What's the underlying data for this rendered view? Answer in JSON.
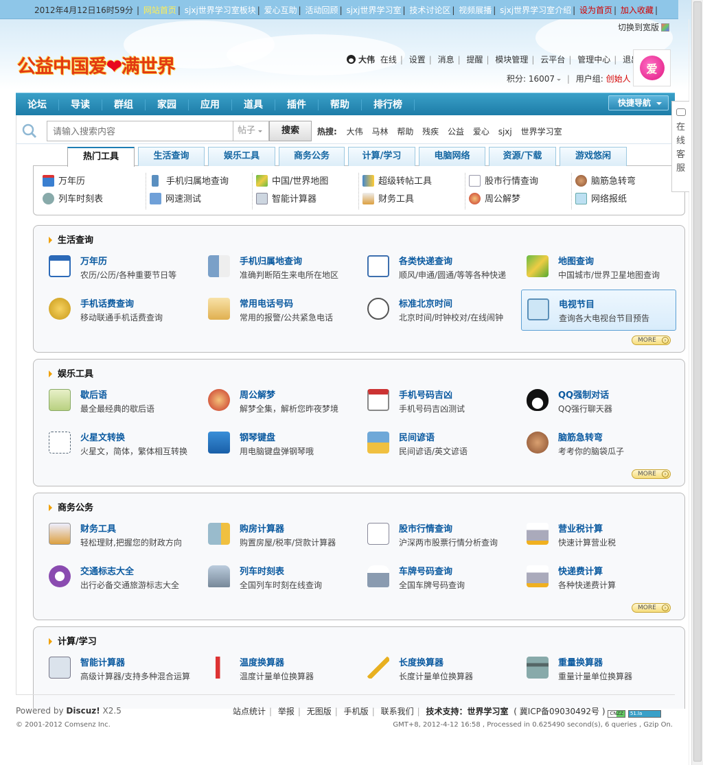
{
  "topbar": {
    "datetime": "2012年4月12日16时59分",
    "links": [
      "网站首页",
      "sjxj世界学习室板块",
      "爱心互助",
      "活动回顾",
      "sjxj世界学习室",
      "技术讨论区",
      "视频展播",
      "sjxj世界学习室介绍",
      "设为首页",
      "加入收藏"
    ]
  },
  "wide_toggle": "切换到宽版",
  "logo": {
    "text_a": "公益中国爱",
    "text_b": "满世界",
    "heart": "❤"
  },
  "user": {
    "name": "大伟",
    "status": "在线",
    "menu": [
      "设置",
      "消息",
      "提醒",
      "模块管理",
      "云平台",
      "管理中心",
      "退出"
    ],
    "points_label": "积分: 16007",
    "group_label": "用户组:",
    "group": "创始人",
    "avatar_text": "爱"
  },
  "nav": {
    "items": [
      "论坛",
      "导读",
      "群组",
      "家园",
      "应用",
      "道具",
      "插件",
      "帮助",
      "排行榜"
    ],
    "quick": "快捷导航"
  },
  "search": {
    "placeholder": "请输入搜索内容",
    "type": "帖子",
    "button": "搜索",
    "hot_label": "热搜:",
    "hot": [
      "大伟",
      "马林",
      "帮助",
      "残疾",
      "公益",
      "爱心",
      "sjxj",
      "世界学习室"
    ]
  },
  "side": {
    "chars": [
      "在",
      "线",
      "客",
      "服"
    ]
  },
  "tabs": [
    "热门工具",
    "生活查询",
    "娱乐工具",
    "商务公务",
    "计算/学习",
    "电脑网络",
    "资源/下载",
    "游戏悠闲"
  ],
  "hot_tools": {
    "row1": [
      "万年历",
      "手机归属地查询",
      "中国/世界地图",
      "超级转帖工具",
      "股市行情查询",
      "脑筋急转弯"
    ],
    "row2": [
      "列车时刻表",
      "网速测试",
      "智能计算器",
      "财务工具",
      "周公解梦",
      "网络报纸"
    ]
  },
  "sections": [
    {
      "title": "生活查询",
      "items": [
        {
          "t": "万年历",
          "d": "农历/公历/各种重要节日等"
        },
        {
          "t": "手机归属地查询",
          "d": "准确判断陌生来电所在地区"
        },
        {
          "t": "各类快递查询",
          "d": "顺风/申通/圆通/等等各种快递"
        },
        {
          "t": "地图查询",
          "d": "中国城市/世界卫星地图查询"
        },
        {
          "t": "手机话费查询",
          "d": "移动联通手机话费查询"
        },
        {
          "t": "常用电话号码",
          "d": "常用的报警/公共紧急电话"
        },
        {
          "t": "标准北京时间",
          "d": "北京时间/时钟校对/在线闹钟"
        },
        {
          "t": "电视节目",
          "d": "查询各大电视台节目预告"
        }
      ],
      "more": "MORE"
    },
    {
      "title": "娱乐工具",
      "items": [
        {
          "t": "歇后语",
          "d": "最全最经典的歇后语"
        },
        {
          "t": "周公解梦",
          "d": "解梦全集，解析您昨夜梦境"
        },
        {
          "t": "手机号码吉凶",
          "d": "手机号码吉凶测试"
        },
        {
          "t": "QQ强制对话",
          "d": "QQ强行聊天器"
        },
        {
          "t": "火星文转换",
          "d": "火星文，简体，繁体相互转换"
        },
        {
          "t": "钢琴键盘",
          "d": "用电脑键盘弹钢琴哦"
        },
        {
          "t": "民间谚语",
          "d": "民间谚语/英文谚语"
        },
        {
          "t": "脑筋急转弯",
          "d": "考考你的脑袋瓜子"
        }
      ],
      "more": "MORE"
    },
    {
      "title": "商务公务",
      "items": [
        {
          "t": "财务工具",
          "d": "轻松理财,把握您的财政方向"
        },
        {
          "t": "购房计算器",
          "d": "购置房屋/税率/贷款计算器"
        },
        {
          "t": "股市行情查询",
          "d": "沪深两市股票行情分析查询"
        },
        {
          "t": "营业税计算",
          "d": "快速计算营业税"
        },
        {
          "t": "交通标志大全",
          "d": "出行必备交通旅游标志大全"
        },
        {
          "t": "列车时刻表",
          "d": "全国列车时刻在线查询"
        },
        {
          "t": "车牌号码查询",
          "d": "全国车牌号码查询"
        },
        {
          "t": "快递费计算",
          "d": "各种快递费计算"
        }
      ],
      "more": "MORE"
    },
    {
      "title": "计算/学习",
      "items": [
        {
          "t": "智能计算器",
          "d": "高级计算器/支持多种混合运算"
        },
        {
          "t": "温度换算器",
          "d": "温度计量单位换算器"
        },
        {
          "t": "长度换算器",
          "d": "长度计量单位换算器"
        },
        {
          "t": "重量换算器",
          "d": "重量计量单位换算器"
        }
      ]
    }
  ],
  "footer": {
    "powered_a": "Powered by ",
    "powered_b": "Discuz!",
    "powered_c": " X2.5",
    "copyright": "© 2001-2012 Comsenz Inc.",
    "links": [
      "站点统计",
      "举报",
      "无图版",
      "手机版",
      "联系我们"
    ],
    "support": "技术支持：世界学习室",
    "icp": "( 冀ICP备09030492号 )",
    "badge1": "CNZZ",
    "badge2": "51.la",
    "process": "GMT+8, 2012-4-12 16:58 , Processed in 0.625490 second(s), 6 queries , Gzip On."
  },
  "colors": {
    "nav": "#1d7ca8",
    "link": "#0b5aa0",
    "accent_red": "#d40000",
    "topbar": "#8ec6e8"
  }
}
